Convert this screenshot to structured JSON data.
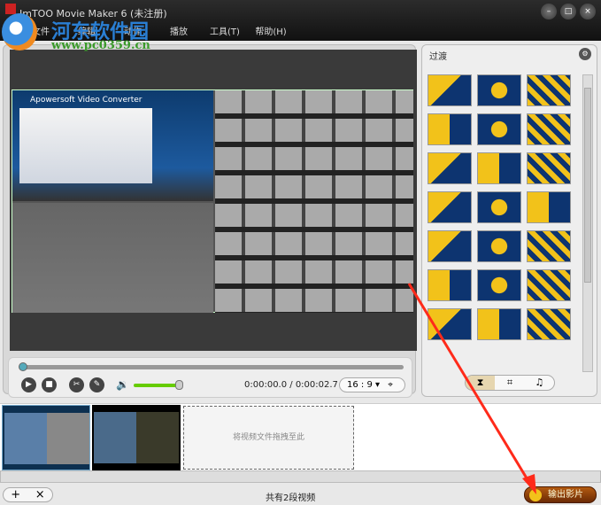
{
  "window": {
    "title": "ImTOO Movie Maker 6 (未注册)"
  },
  "watermark": {
    "name": "河东软件园",
    "url": "www.pc0359.cn"
  },
  "menu": [
    "文件",
    "编辑",
    "动作",
    "播放",
    "工具(T)",
    "帮助(H)"
  ],
  "preview": {
    "video_caption": "Apowersoft Video Converter",
    "current_time": "0:00:00.0",
    "total_time": "0:00:02.7",
    "time_display": "0:00:00.0 / 0:00:02.7",
    "aspect_ratio": "16 : 9",
    "seek_progress": 0,
    "volume": 0.95
  },
  "side_panel": {
    "title": "过渡",
    "transition_count": 21,
    "tabs": [
      "transition-icon",
      "crop-icon",
      "music-icon"
    ]
  },
  "timeline": {
    "drop_hint": "将视频文件拖拽至此",
    "clips": 2
  },
  "footer": {
    "count_text": "共有2段视频",
    "add": "+",
    "remove": "×",
    "export_label": "输出影片"
  },
  "colors": {
    "accent_arrow": "#ff2a1a",
    "volume": "#66cc00",
    "export": "#8b3a08"
  }
}
